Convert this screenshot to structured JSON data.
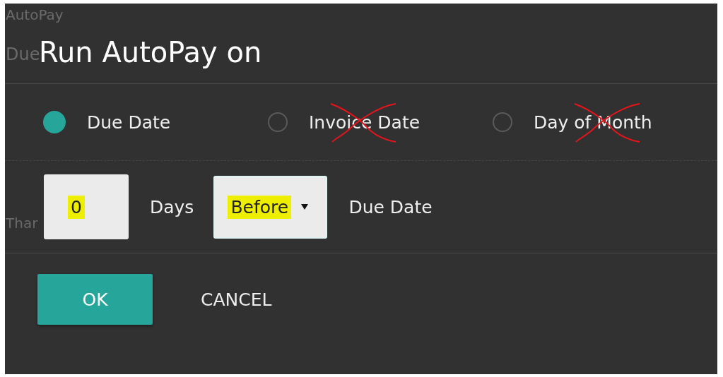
{
  "background": {
    "texts": [
      "AutoPay",
      "Due",
      "Thar"
    ]
  },
  "dialog": {
    "title": "Run AutoPay on",
    "options": [
      {
        "label": "Due Date",
        "selected": true,
        "struck": false
      },
      {
        "label": "Invoice Date",
        "selected": false,
        "struck": true
      },
      {
        "label": "Day of Month",
        "selected": false,
        "struck": true
      }
    ],
    "offset": {
      "value": "0",
      "highlighted": true
    },
    "unit": "Days",
    "direction": {
      "value": "Before",
      "highlighted": true
    },
    "reference": "Due Date",
    "buttons": [
      {
        "label": "OK",
        "kind": "primary"
      },
      {
        "label": "CANCEL",
        "kind": "flat"
      }
    ]
  }
}
